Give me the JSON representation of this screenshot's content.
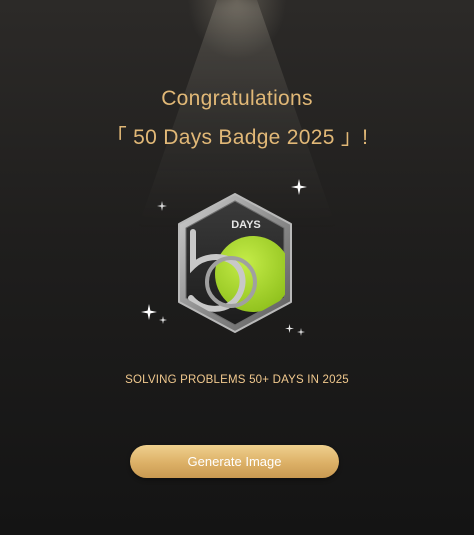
{
  "dialog": {
    "title_line1": "Congratulations",
    "title_line2": "「 50 Days Badge 2025 」!",
    "caption": "SOLVING PROBLEMS 50+ DAYS IN 2025",
    "generate_button_label": "Generate Image"
  },
  "badge": {
    "label": "DAYS",
    "accent_color": "#a6d22c",
    "frame_color": "#9a9a9a"
  },
  "colors": {
    "title": "#e1b877",
    "caption": "#f1c98e",
    "button": "#dcb066"
  }
}
